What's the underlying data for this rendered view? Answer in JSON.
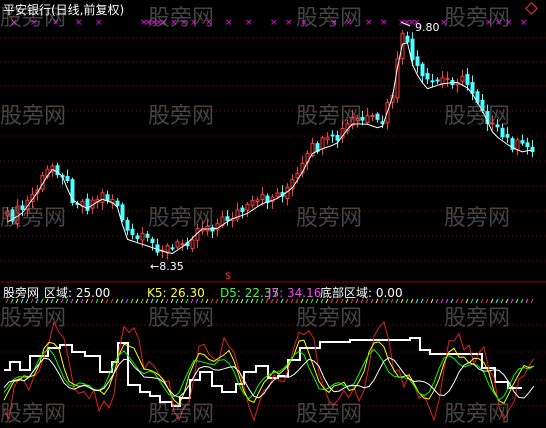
{
  "main_panel": {
    "title": "平安银行(日线,前复权)",
    "price_high_label": "9.80",
    "price_low_label": "8.35",
    "arrow_prefix": "←",
    "marker": "$"
  },
  "indicator_panel": {
    "name": "股旁网",
    "zone_label": "区域: 25.00",
    "k5_label": "K5: 26.30",
    "d5_label": "D5: 22.37",
    "j5_label": "J5: 34.16",
    "bottom_zone_label": "底部区域: 0.00"
  },
  "watermark_text": "股旁网",
  "colors": {
    "up": "#ff3c3c",
    "down": "#50ffff",
    "ma": "#ffffff",
    "k5": "#ffff00",
    "d5": "#00ff00",
    "j5": "#ff00ff",
    "zone": "#ffffff",
    "grid": "#8b0000"
  },
  "icons": [
    "diamond-icon"
  ]
}
